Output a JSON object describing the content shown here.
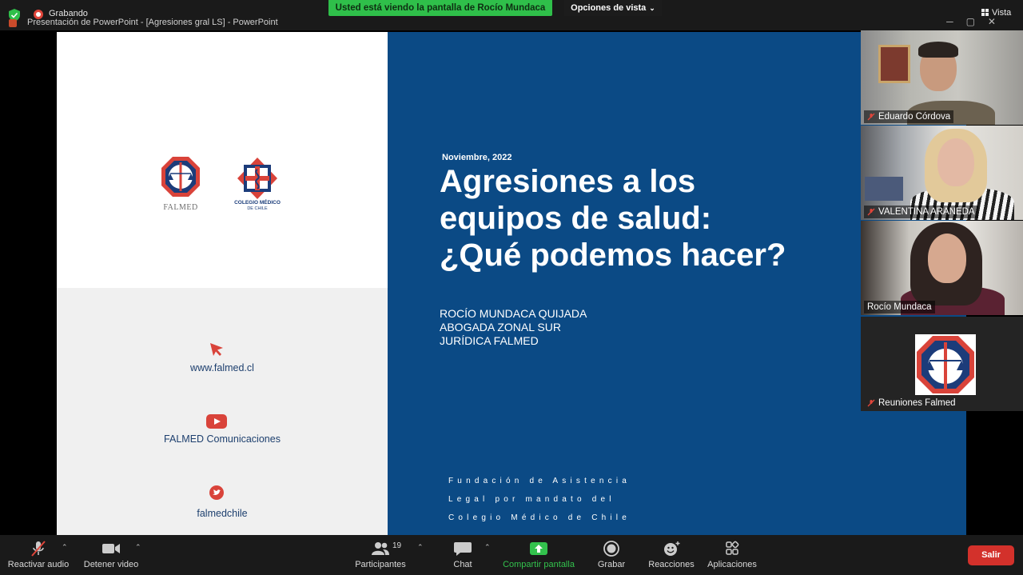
{
  "meeting": {
    "recording_label": "Grabando",
    "window_title": "Presentación de PowerPoint - [Agresiones gral LS] - PowerPoint",
    "share_banner": "Usted está viendo la pantalla de Rocío Mundaca",
    "view_options": "Opciones de vista",
    "view_button": "Vista"
  },
  "slide": {
    "logos": {
      "falmed": "FALMED",
      "colegio_line1": "COLEGIO MÉDICO",
      "colegio_line2": "DE CHILE"
    },
    "contacts": [
      {
        "icon": "cursor-icon",
        "text": "www.falmed.cl"
      },
      {
        "icon": "youtube-icon",
        "text": "FALMED Comunicaciones"
      },
      {
        "icon": "twitter-icon",
        "text": "falmedchile"
      }
    ],
    "date": "Noviembre, 2022",
    "title_lines": [
      "Agresiones a los",
      "equipos de salud:",
      "¿Qué podemos hacer?"
    ],
    "author_lines": [
      "ROCÍO MUNDACA QUIJADA",
      "ABOGADA ZONAL SUR",
      "JURÍDICA FALMED"
    ],
    "foundation_lines": [
      "Fundación de Asistencia",
      "Legal por mandato del",
      "Colegio Médico de Chile"
    ]
  },
  "participants": [
    {
      "name": "Eduardo Córdova",
      "muted": true
    },
    {
      "name": "VALENTINA ARANEDA",
      "muted": true
    },
    {
      "name": "Rocío Mundaca",
      "muted": false,
      "active_speaker": true
    },
    {
      "name": "Reuniones Falmed",
      "muted": true
    }
  ],
  "toolbar": {
    "audio": "Reactivar audio",
    "video": "Detener video",
    "participants": "Participantes",
    "participants_count": "19",
    "chat": "Chat",
    "share": "Compartir pantalla",
    "record": "Grabar",
    "reactions": "Reacciones",
    "apps": "Aplicaciones",
    "leave": "Salir"
  },
  "colors": {
    "slide_blue": "#0b4a85",
    "share_green": "#2fbf4a",
    "leave_red": "#d3312b",
    "falmed_red": "#e0453a"
  }
}
